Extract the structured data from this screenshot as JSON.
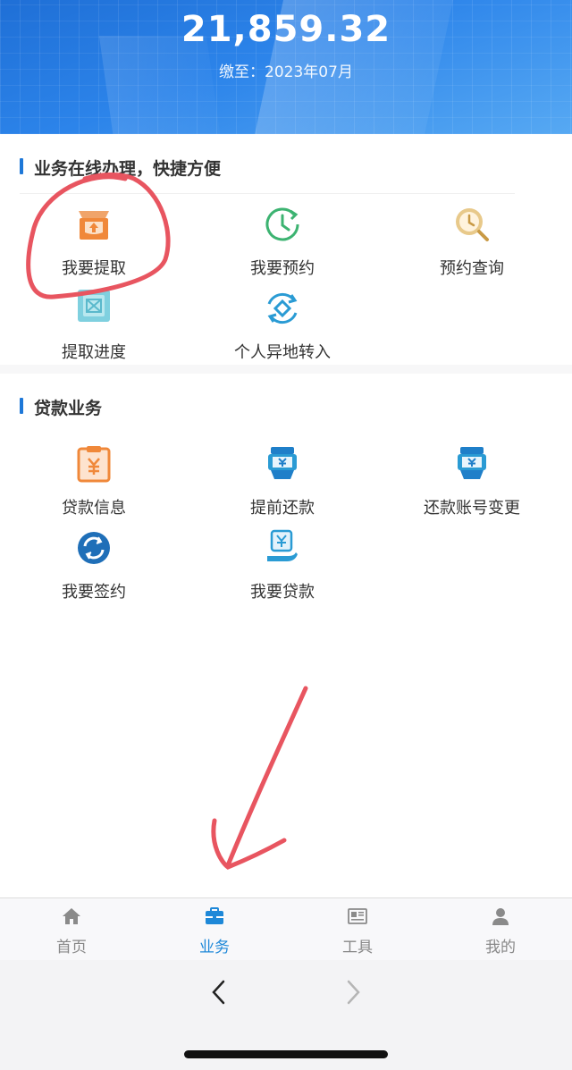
{
  "header": {
    "balance": "21,859.32",
    "paid_to": "缴至：2023年07月"
  },
  "online_section": {
    "title": "业务在线办理，快捷方便",
    "items": [
      {
        "label": "我要提取",
        "icon": "withdraw-tray-icon"
      },
      {
        "label": "我要预约",
        "icon": "clock-refresh-icon"
      },
      {
        "label": "预约查询",
        "icon": "clock-search-icon"
      },
      {
        "label": "提取进度",
        "icon": "progress-doc-icon"
      },
      {
        "label": "个人异地转入",
        "icon": "transfer-cycle-icon"
      }
    ]
  },
  "loan_section": {
    "title": "贷款业务",
    "items": [
      {
        "label": "贷款信息",
        "icon": "loan-clipboard-icon"
      },
      {
        "label": "提前还款",
        "icon": "hand-yen-icon"
      },
      {
        "label": "还款账号变更",
        "icon": "hand-yen-icon"
      },
      {
        "label": "我要签约",
        "icon": "sign-refresh-icon"
      },
      {
        "label": "我要贷款",
        "icon": "yen-hand-icon"
      }
    ]
  },
  "tabbar": {
    "items": [
      {
        "label": "首页",
        "icon": "home-icon",
        "active": false
      },
      {
        "label": "业务",
        "icon": "briefcase-icon",
        "active": true
      },
      {
        "label": "工具",
        "icon": "newspaper-icon",
        "active": false
      },
      {
        "label": "我的",
        "icon": "person-icon",
        "active": false
      }
    ]
  },
  "colors": {
    "accent": "#1e88d8",
    "orange": "#f0883a",
    "green": "#3cb371",
    "gold": "#d9b368",
    "annotation": "#e85560"
  }
}
